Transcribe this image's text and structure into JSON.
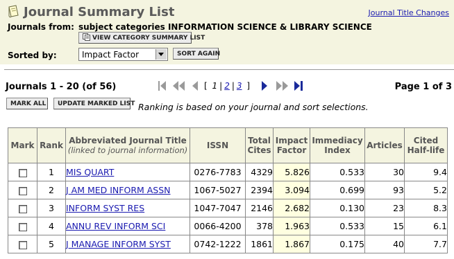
{
  "header": {
    "title": "Journal Summary List",
    "title_changes_link": "Journal Title Changes",
    "journals_from_label": "Journals from:",
    "journals_from_value": "subject categories INFORMATION SCIENCE & LIBRARY SCIENCE",
    "view_category_button": "VIEW CATEGORY SUMMARY LIST",
    "sorted_by_label": "Sorted by:",
    "sort_select_value": "Impact Factor",
    "sort_again_button": "SORT AGAIN"
  },
  "pager": {
    "count_text": "Journals 1 - 20 (of 56)",
    "open_bracket": "[",
    "close_bracket": "]",
    "pages": [
      "1",
      "2",
      "3"
    ],
    "current_page": "1",
    "page_of_text": "Page 1 of 3"
  },
  "actions": {
    "mark_all_button": "MARK ALL",
    "update_marked_button": "UPDATE MARKED LIST",
    "ranking_note": "Ranking is based on your journal and sort selections."
  },
  "table": {
    "headers": {
      "mark": "Mark",
      "rank": "Rank",
      "title": "Abbreviated Journal Title",
      "title_sub": "(linked to journal information)",
      "issn": "ISSN",
      "total_cites_1": "Total",
      "total_cites_2": "Cites",
      "impact_1": "Impact",
      "impact_2": "Factor",
      "immediacy_1": "Immediacy",
      "immediacy_2": "Index",
      "articles": "Articles",
      "cited_1": "Cited",
      "cited_2": "Half-life"
    },
    "rows": [
      {
        "rank": "1",
        "title": "MIS QUART",
        "issn": "0276-7783",
        "total_cites": "4329",
        "impact_factor": "5.826",
        "immediacy": "0.533",
        "articles": "30",
        "half_life": "9.4"
      },
      {
        "rank": "2",
        "title": "J AM MED INFORM ASSN",
        "issn": "1067-5027",
        "total_cites": "2394",
        "impact_factor": "3.094",
        "immediacy": "0.699",
        "articles": "93",
        "half_life": "5.2"
      },
      {
        "rank": "3",
        "title": "INFORM SYST RES",
        "issn": "1047-7047",
        "total_cites": "2146",
        "impact_factor": "2.682",
        "immediacy": "0.130",
        "articles": "23",
        "half_life": "8.3"
      },
      {
        "rank": "4",
        "title": "ANNU REV INFORM SCI",
        "issn": "0066-4200",
        "total_cites": "378",
        "impact_factor": "1.963",
        "immediacy": "0.533",
        "articles": "15",
        "half_life": "6.1"
      },
      {
        "rank": "5",
        "title": "J MANAGE INFORM SYST",
        "issn": "0742-1222",
        "total_cites": "1861",
        "impact_factor": "1.867",
        "immediacy": "0.175",
        "articles": "40",
        "half_life": "7.7"
      }
    ]
  },
  "colors": {
    "header_bg": "#f4f4e0",
    "link": "#1a1ab0",
    "impact_cell_bg": "#ffffe0",
    "pager_arrow_active": "#1a2a9a",
    "pager_arrow_inactive": "#9a9a9a"
  },
  "icons": [
    "scroll-icon",
    "category-list-icon",
    "first-page-icon",
    "fast-back-icon",
    "prev-page-icon",
    "next-page-icon",
    "fast-forward-icon",
    "last-page-icon",
    "dropdown-arrow-icon",
    "checkbox"
  ]
}
